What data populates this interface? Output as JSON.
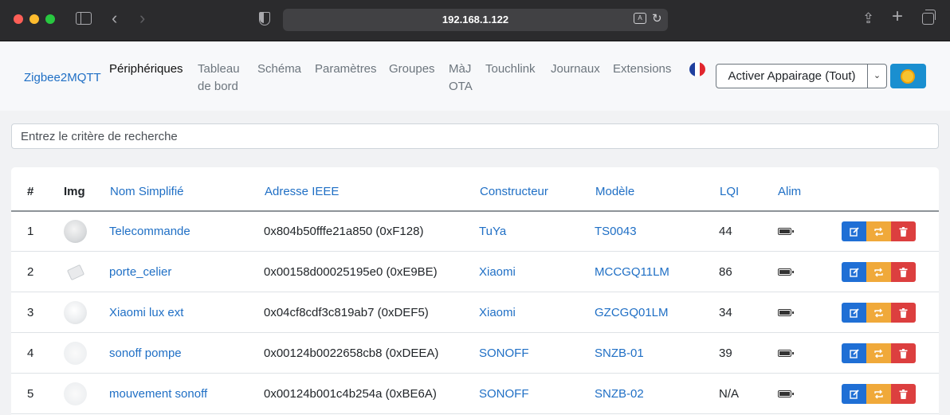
{
  "browser": {
    "url": "192.168.1.122",
    "icons": [
      "sidebar-icon",
      "back-icon",
      "forward-icon",
      "shield-icon",
      "translate-icon",
      "reload-icon",
      "share-icon",
      "new-tab-icon",
      "tabs-overview-icon"
    ]
  },
  "navbar": {
    "brand": "Zigbee2MQTT",
    "items": [
      {
        "l1": "Périphériques",
        "l2": "",
        "active": true
      },
      {
        "l1": "Tableau",
        "l2": "de bord",
        "active": false
      },
      {
        "l1": "Schéma",
        "l2": "",
        "active": false
      },
      {
        "l1": "Paramètres",
        "l2": "",
        "active": false
      },
      {
        "l1": "Groupes",
        "l2": "",
        "active": false
      },
      {
        "l1": "MàJ",
        "l2": "OTA",
        "active": false
      },
      {
        "l1": "Touchlink",
        "l2": "",
        "active": false
      },
      {
        "l1": "Journaux",
        "l2": "",
        "active": false
      },
      {
        "l1": "Extensions",
        "l2": "",
        "active": false
      }
    ],
    "language_icon": "france-flag-icon",
    "permit_join_label": "Activer Appairage (Tout)",
    "theme_icon": "sun-icon"
  },
  "search": {
    "placeholder": "Entrez le critère de recherche",
    "value": ""
  },
  "table": {
    "headers": {
      "num": "#",
      "img": "Img",
      "name": "Nom Simplifié",
      "ieee": "Adresse IEEE",
      "vendor": "Constructeur",
      "model": "Modèle",
      "lqi": "LQI",
      "power": "Alim"
    },
    "rows": [
      {
        "num": "1",
        "name": "Telecommande",
        "ieee": "0x804b50fffe21a850 (0xF128)",
        "vendor": "TuYa",
        "model": "TS0043",
        "lqi": "44",
        "power": "battery-icon"
      },
      {
        "num": "2",
        "name": "porte_celier",
        "ieee": "0x00158d00025195e0 (0xE9BE)",
        "vendor": "Xiaomi",
        "model": "MCCGQ11LM",
        "lqi": "86",
        "power": "battery-icon"
      },
      {
        "num": "3",
        "name": "Xiaomi lux ext",
        "ieee": "0x04cf8cdf3c819ab7 (0xDEF5)",
        "vendor": "Xiaomi",
        "model": "GZCGQ01LM",
        "lqi": "34",
        "power": "battery-icon"
      },
      {
        "num": "4",
        "name": "sonoff pompe",
        "ieee": "0x00124b0022658cb8 (0xDEEA)",
        "vendor": "SONOFF",
        "model": "SNZB-01",
        "lqi": "39",
        "power": "battery-icon"
      },
      {
        "num": "5",
        "name": "mouvement sonoff",
        "ieee": "0x00124b001c4b254a (0xBE6A)",
        "vendor": "SONOFF",
        "model": "SNZB-02",
        "lqi": "N/A",
        "power": "battery-icon"
      }
    ],
    "row_actions": [
      "edit-icon",
      "rename-icon",
      "trash-icon"
    ]
  },
  "colors": {
    "link": "#1f6fc5",
    "edit": "#1f6fd5",
    "rename": "#f0a93a",
    "remove": "#dc3f3f",
    "theme_button": "#1a8fd0"
  }
}
